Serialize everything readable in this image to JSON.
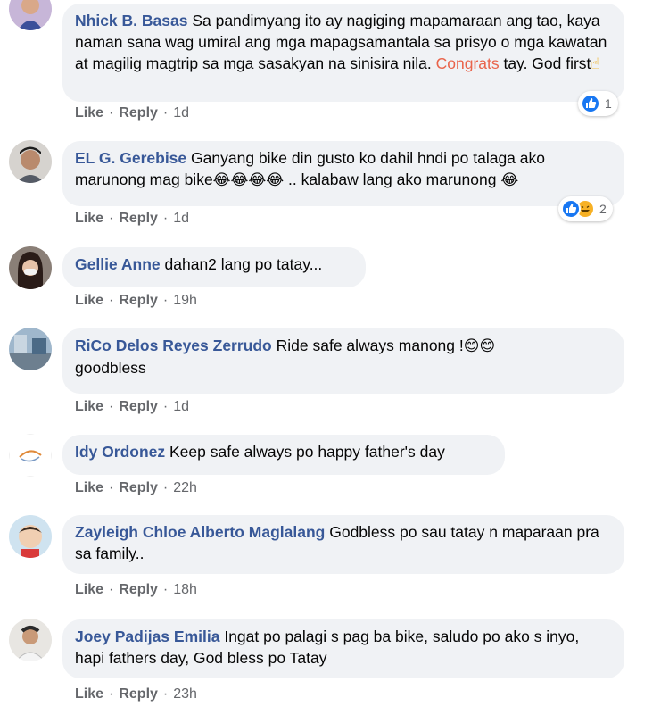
{
  "comments": [
    {
      "author": "Nhick B. Basas",
      "text_1": "Sa pandimyang ito ay nagiging mapamaraan ang tao, kaya naman sana wag umiral ang mga mapagsamantala sa prisyo o mga kawatan at magilig magtrip sa mga sasakyan na sinisira nila. ",
      "highlight": "Congrats",
      "text_2": " tay. God first",
      "emoji": "☝",
      "like": "Like",
      "reply": "Reply",
      "time": "1d",
      "reaction_count": "1",
      "reaction_icons": [
        "like-icon"
      ]
    },
    {
      "author": "EL G. Gerebise",
      "text_1": "Ganyang bike din gusto ko dahil hndi po talaga ako marunong mag bike",
      "emoji_1": "😂😂😂😂",
      "text_2": " .. kalabaw lang ako marunong ",
      "emoji_2": "😂",
      "like": "Like",
      "reply": "Reply",
      "time": "1d",
      "reaction_count": "2",
      "reaction_icons": [
        "like-icon",
        "haha-icon"
      ]
    },
    {
      "author": "Gellie Anne",
      "text": "dahan2 lang po tatay...",
      "like": "Like",
      "reply": "Reply",
      "time": "19h"
    },
    {
      "author": "RiCo Delos Reyes Zerrudo",
      "text": "Ride safe always manong !",
      "emoji": "😊😊",
      "text_2": "goodbless",
      "like": "Like",
      "reply": "Reply",
      "time": "1d"
    },
    {
      "author": "Idy Ordonez",
      "text": "Keep safe always po happy father's day",
      "like": "Like",
      "reply": "Reply",
      "time": "22h"
    },
    {
      "author": "Zayleigh Chloe Alberto Maglalang",
      "text": "Godbless po sau tatay n maparaan pra sa family..",
      "like": "Like",
      "reply": "Reply",
      "time": "18h"
    },
    {
      "author": "Joey Padijas Emilia",
      "text": "Ingat po palagi s pag ba bike, saludo po ako s inyo, hapi fathers day, God bless po Tatay",
      "like": "Like",
      "reply": "Reply",
      "time": "23h"
    }
  ],
  "separator": "·",
  "colors": {
    "author": "#385898",
    "bubble": "#f0f2f5",
    "meta": "#65676b",
    "highlight": "#e9634a",
    "like_blue": "#1877f2",
    "haha_yellow": "#f7b125"
  }
}
